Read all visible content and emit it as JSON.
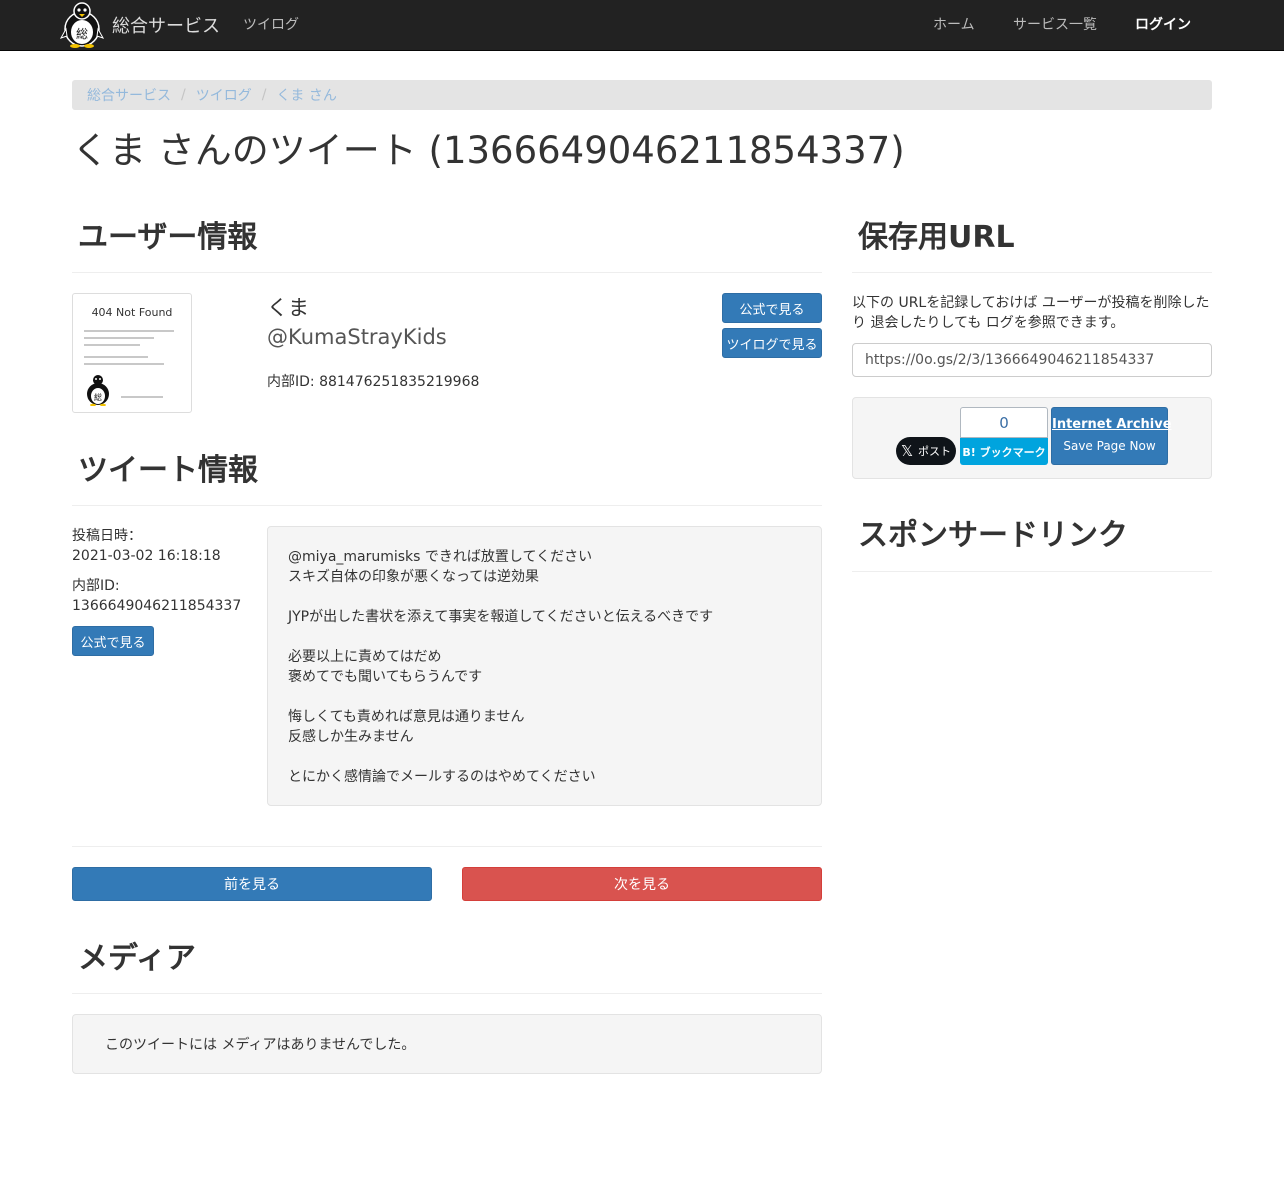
{
  "navbar": {
    "brand": "総合サービス",
    "brand_logo_glyph": "総",
    "twilog": "ツイログ",
    "home": "ホーム",
    "services": "サービス一覧",
    "login": "ログイン",
    "glyph": ""
  },
  "breadcrumb": [
    "総合サービス",
    "ツイログ",
    "くま さん"
  ],
  "page_title": "くま さんのツイート (1366649046211854337)",
  "user_section": {
    "heading": "ユーザー情報",
    "avatar_title": "404 Not Found",
    "avatar_logo_glyph": "総",
    "name": "くま",
    "handle": "@KumaStrayKids",
    "internal_id": "内部ID: 881476251835219968",
    "btn_official": "公式で見る",
    "btn_twilog": "ツイログで見る"
  },
  "tweet_section": {
    "heading": "ツイート情報",
    "posted_label": "投稿日時：",
    "posted_value": "2021-03-02 16:18:18",
    "id_label": "内部ID:",
    "id_value": "1366649046211854337",
    "btn_official": "公式で見る",
    "lines": [
      "@miya_marumisks できれば放置してください",
      "スキズ自体の印象が悪くなっては逆効果",
      "",
      "JYPが出した書状を添えて事実を報道してくださいと伝えるべきです",
      "",
      "必要以上に責めてはだめ",
      "褒めてでも聞いてもらうんです",
      "",
      "悔しくても責めれば意見は通りません",
      "反感しか生みません",
      "",
      "とにかく感情論でメールするのはやめてください"
    ]
  },
  "pager": {
    "prev": "前を見る",
    "next": "次を見る"
  },
  "media_section": {
    "heading": "メディア",
    "empty_text": "このツイートには メディアはありませんでした。"
  },
  "save_section": {
    "heading": "保存用URL",
    "description": "以下の URLを記録しておけば ユーザーが投稿を削除したり 退会したりしても ログを参照できます。",
    "url_value": "https://0o.gs/2/3/1366649046211854337",
    "x_label": "ポスト",
    "hatena_count": "0",
    "hatena_label": "B! ブックマーク",
    "ia_title": "Internet Archive",
    "ia_sub": "Save Page Now"
  },
  "sponsor_section": {
    "heading": "スポンサードリンク"
  },
  "colors": {
    "navbar_bg": "#222222",
    "primary": "#337ab7",
    "danger": "#d9534f",
    "hatena": "#00a4de"
  }
}
